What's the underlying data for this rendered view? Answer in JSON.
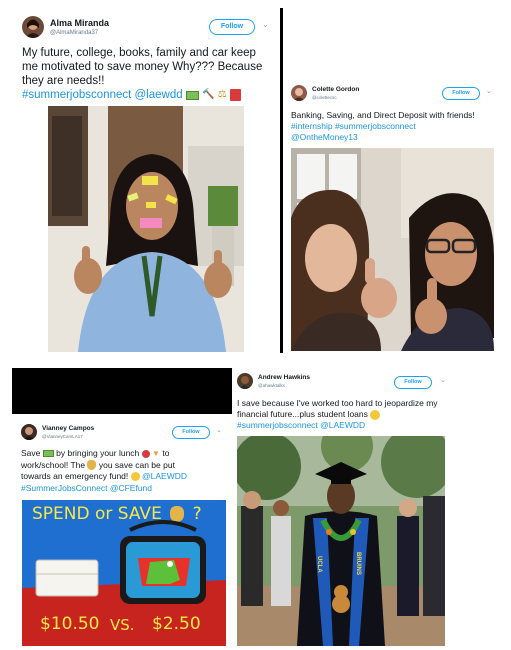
{
  "cards": {
    "alma": {
      "name": "Alma Miranda",
      "handle": "@AlmaMiranda37",
      "follow": "Follow",
      "text": "My future, college, books, family and car keep me motivated to save money   Why??? Because they are needs!!",
      "tags": "#summerjobsconnect @laewdd"
    },
    "colette": {
      "name": "Colette Gordon",
      "handle": "@colettecsc",
      "follow": "Follow",
      "text": "Banking, Saving, and Direct Deposit with friends!",
      "tags1": "#internship #summerjobsconnect",
      "tags2": "@OntheMoney13"
    },
    "vianney": {
      "name": "Vianney Campos",
      "handle": "@VianneyCamLA17",
      "follow": "Follow",
      "t1": "Save",
      "t2": "by bringing your lunch",
      "t3": "to",
      "t4": "work/school! The",
      "t5": "you save can be put",
      "t6": "towards an emergency fund!",
      "tags1": "@LAEWDD",
      "tags2": "#SummerJobsConnect @CFEfund",
      "poster_title": "SPEND or SAVE",
      "poster_q": "?",
      "price_left": "$10.50",
      "vs": "VS.",
      "price_right": "$2.50"
    },
    "andrew": {
      "name": "Andrew Hawkins",
      "handle": "@ahawktalks",
      "follow": "Follow",
      "text": "I save because I've worked too hard to jeopardize my financial future...plus student loans",
      "tags": "#summerjobsconnect @LAEWDD",
      "stole_left": "UCLA",
      "stole_right": "BRUINS"
    }
  },
  "colors": {
    "link": "#1b95e0",
    "follow_border": "#1da1f2",
    "bar": "#000000"
  }
}
